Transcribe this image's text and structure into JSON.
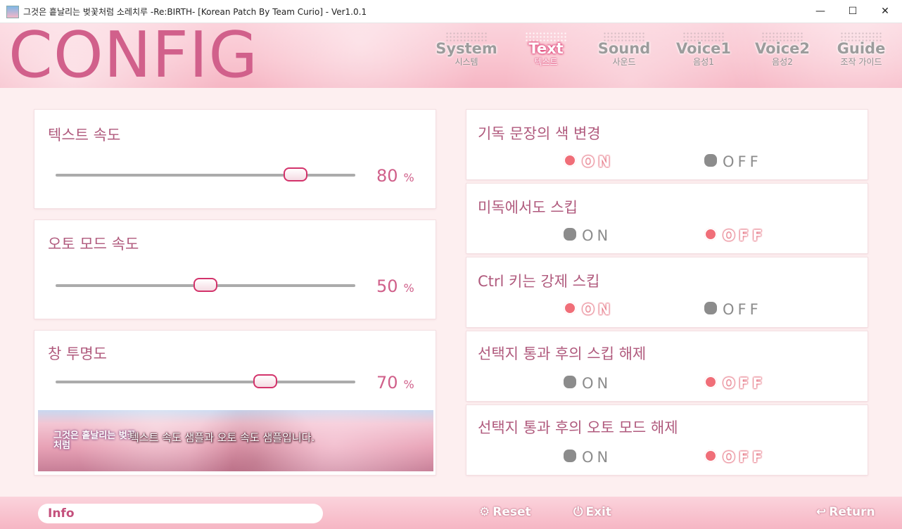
{
  "window": {
    "title": "그것은 흩날리는 벚꽃처럼 소레치루 -Re:BIRTH- [Korean Patch By Team Curio] - Ver1.0.1",
    "minimize": "—",
    "maximize": "☐",
    "close": "✕"
  },
  "header": {
    "title": "CONFIG",
    "tabs": [
      {
        "en": "System",
        "ko": "시스템",
        "active": false
      },
      {
        "en": "Text",
        "ko": "텍스트",
        "active": true
      },
      {
        "en": "Sound",
        "ko": "사운드",
        "active": false
      },
      {
        "en": "Voice1",
        "ko": "음성1",
        "active": false
      },
      {
        "en": "Voice2",
        "ko": "음성2",
        "active": false
      },
      {
        "en": "Guide",
        "ko": "조작 가이드",
        "active": false
      }
    ]
  },
  "sliders": [
    {
      "label": "텍스트 속도",
      "value": "80",
      "unit": "%",
      "fraction": 0.8
    },
    {
      "label": "오토 모드 속도",
      "value": "50",
      "unit": "%",
      "fraction": 0.5
    },
    {
      "label": "창 투명도",
      "value": "70",
      "unit": "%",
      "fraction": 0.7
    }
  ],
  "sample": {
    "logo": "그것은 흩날리는 벚꽃처럼",
    "text": "텍스트 속도 샘플과 오토 속도 샘플입니다."
  },
  "options": [
    {
      "label": "기독 문장의 색 변경",
      "on": "ON",
      "off": "OFF",
      "selected": "on"
    },
    {
      "label": "미독에서도 스킵",
      "on": "ON",
      "off": "OFF",
      "selected": "off"
    },
    {
      "label": "Ctrl 키는 강제 스킵",
      "on": "ON",
      "off": "OFF",
      "selected": "on"
    },
    {
      "label": "선택지 통과 후의 스킵 해제",
      "on": "ON",
      "off": "OFF",
      "selected": "off"
    },
    {
      "label": "선택지 통과 후의 오토 모드 해제",
      "on": "ON",
      "off": "OFF",
      "selected": "off"
    }
  ],
  "footer": {
    "info": "Info",
    "reset": "Reset",
    "exit": "Exit",
    "return": "Return"
  },
  "colors": {
    "accent": "#d1608b",
    "selected_toggle": "#f06e78",
    "header_bg": "#f9c5d0"
  }
}
